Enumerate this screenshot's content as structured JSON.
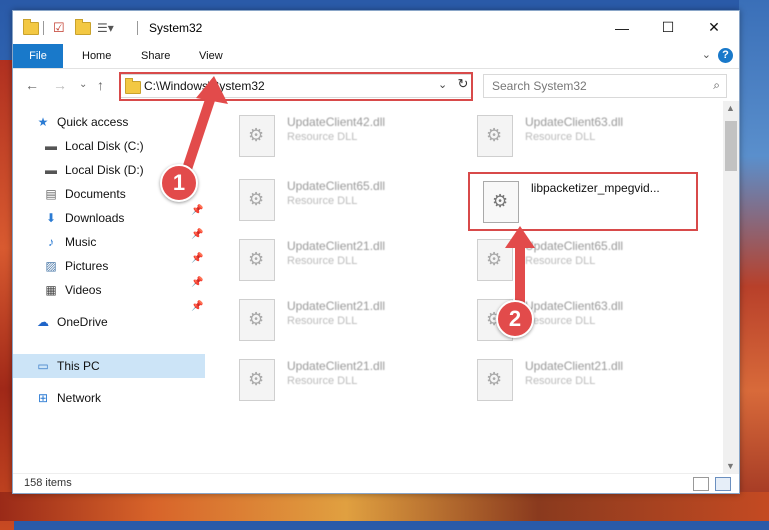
{
  "window": {
    "title": "System32",
    "controls": {
      "minimize": "—",
      "maximize": "☐",
      "close": "✕"
    }
  },
  "ribbon": {
    "tabs": [
      "File",
      "Home",
      "Share",
      "View"
    ],
    "help": "?",
    "collapse": "⌄"
  },
  "navigation": {
    "back": "←",
    "forward": "→",
    "recent": "⌄",
    "up": "↑",
    "address": "C:\\Windows\\System32",
    "address_dropdown": "⌄",
    "refresh": "↻",
    "search_placeholder": "Search System32",
    "search_icon": "search-icon"
  },
  "sidebar": {
    "items": [
      {
        "label": "Quick access",
        "icon": "star-icon",
        "glyph": "★",
        "color": "#2b7bd3"
      },
      {
        "label": "Local Disk (C:)",
        "icon": "drive-icon",
        "glyph": "▬",
        "color": "#555555"
      },
      {
        "label": "Local Disk (D:)",
        "icon": "drive-icon",
        "glyph": "▬",
        "color": "#555555"
      },
      {
        "label": "Documents",
        "icon": "documents-icon",
        "glyph": "▤",
        "color": "#666666",
        "pinned": true
      },
      {
        "label": "Downloads",
        "icon": "download-icon",
        "glyph": "⬇",
        "color": "#2b7bd3",
        "pinned": true
      },
      {
        "label": "Music",
        "icon": "music-icon",
        "glyph": "♪",
        "color": "#2b7bd3",
        "pinned": true
      },
      {
        "label": "Pictures",
        "icon": "pictures-icon",
        "glyph": "▨",
        "color": "#4a78a8",
        "pinned": true
      },
      {
        "label": "Videos",
        "icon": "videos-icon",
        "glyph": "▦",
        "color": "#444444",
        "pinned": true
      },
      {
        "label": "OneDrive",
        "icon": "cloud-icon",
        "glyph": "☁",
        "color": "#1e64c8"
      },
      {
        "label": "This PC",
        "icon": "computer-icon",
        "glyph": "🖥",
        "color": "#3a7cc8",
        "selected": true
      },
      {
        "label": "Network",
        "icon": "network-icon",
        "glyph": "⊞",
        "color": "#2b7bd3"
      }
    ],
    "pin_glyph": "📌"
  },
  "files": [
    {
      "name": "UpdateClient42.dll",
      "type": "Resource DLL"
    },
    {
      "name": "UpdateClient63.dll",
      "type": "Resource DLL"
    },
    {
      "name": "UpdateClient65.dll",
      "type": "Resource DLL"
    },
    {
      "name": "libpacketizer_mpegvid...",
      "type": "",
      "highlighted": true
    },
    {
      "name": "UpdateClient21.dll",
      "type": "Resource DLL"
    },
    {
      "name": "UpdateClient65.dll",
      "type": "Resource DLL"
    },
    {
      "name": "UpdateClient21.dll",
      "type": "Resource DLL"
    },
    {
      "name": "UpdateClient63.dll",
      "type": "Resource DLL"
    },
    {
      "name": "UpdateClient21.dll",
      "type": "Resource DLL"
    },
    {
      "name": "UpdateClient21.dll",
      "type": "Resource DLL"
    }
  ],
  "status": {
    "item_count": "158 items"
  },
  "annotations": {
    "step1": "1",
    "step2": "2",
    "highlight_color": "#d84a4a"
  }
}
